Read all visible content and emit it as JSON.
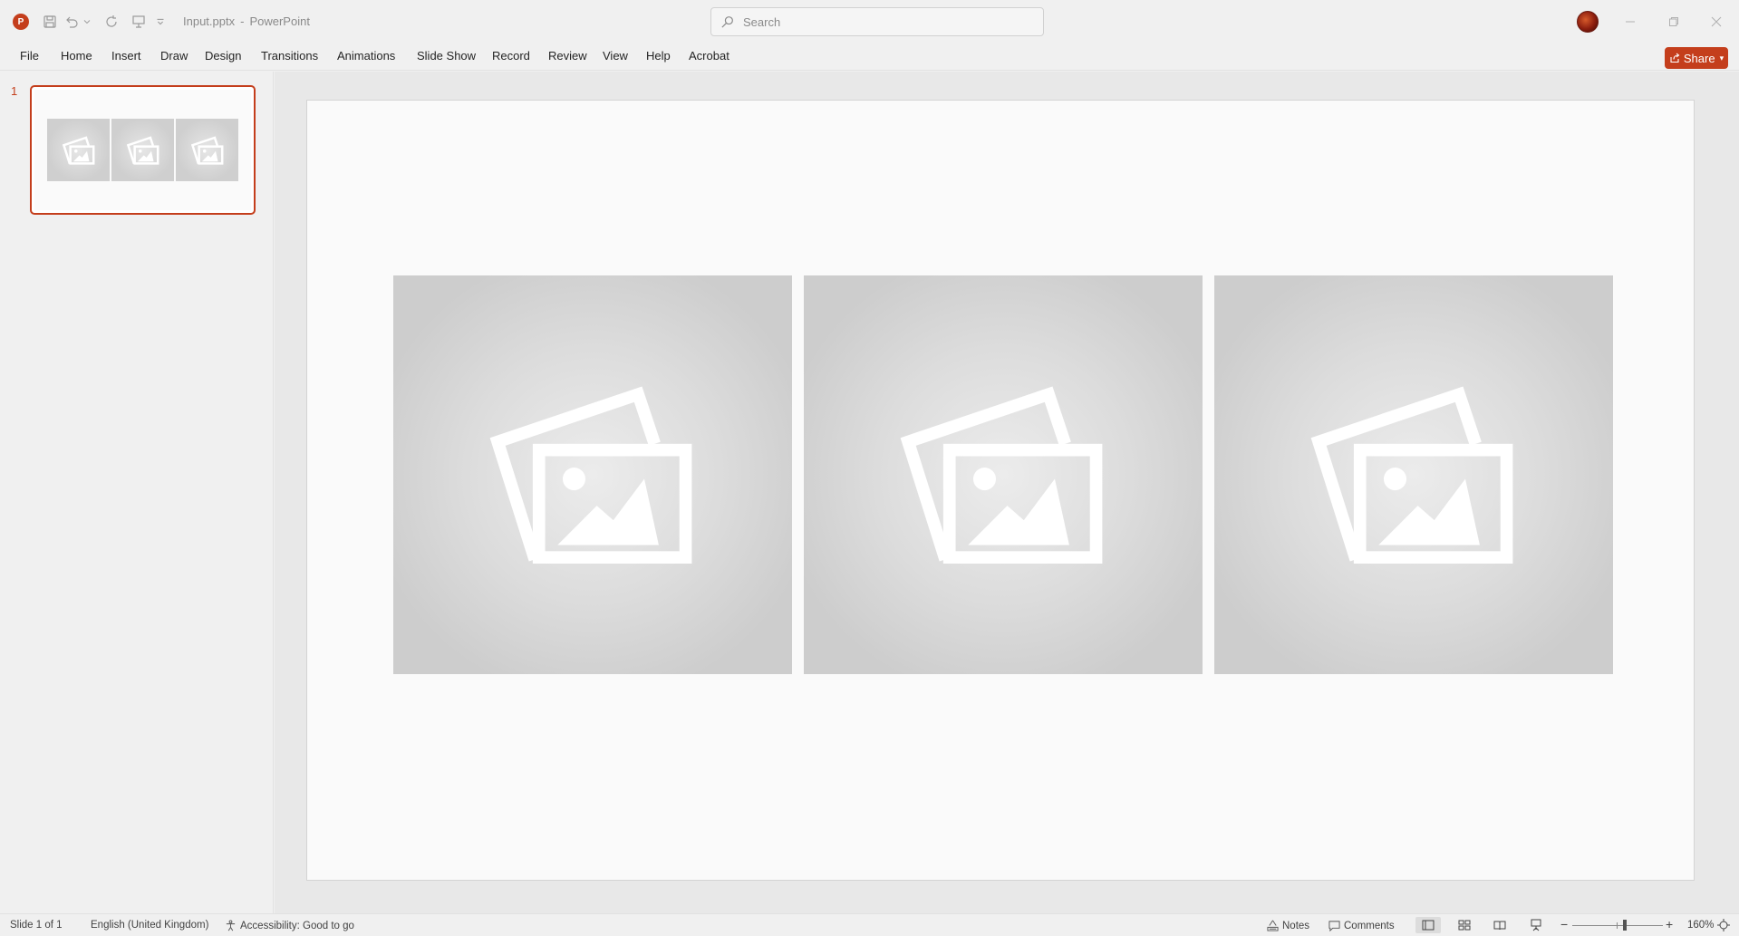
{
  "app": {
    "logo_letter": "P",
    "file_name": "Input.pptx",
    "separator": "-",
    "app_name": "PowerPoint"
  },
  "search": {
    "placeholder": "Search"
  },
  "tabs": [
    "File",
    "Home",
    "Insert",
    "Draw",
    "Design",
    "Transitions",
    "Animations",
    "Slide Show",
    "Record",
    "Review",
    "View",
    "Help",
    "Acrobat"
  ],
  "share": {
    "label": "Share"
  },
  "thumbnails": [
    {
      "number": "1"
    }
  ],
  "status": {
    "slide_info": "Slide 1 of 1",
    "language": "English (United Kingdom)",
    "accessibility": "Accessibility: Good to go",
    "notes": "Notes",
    "comments": "Comments",
    "zoom_minus": "−",
    "zoom_plus": "+",
    "zoom_level": "160%"
  },
  "colors": {
    "accent": "#c43e1c",
    "placeholder": "#d0d0d0"
  },
  "icons": {
    "placeholder": "picture-placeholder-icon"
  }
}
